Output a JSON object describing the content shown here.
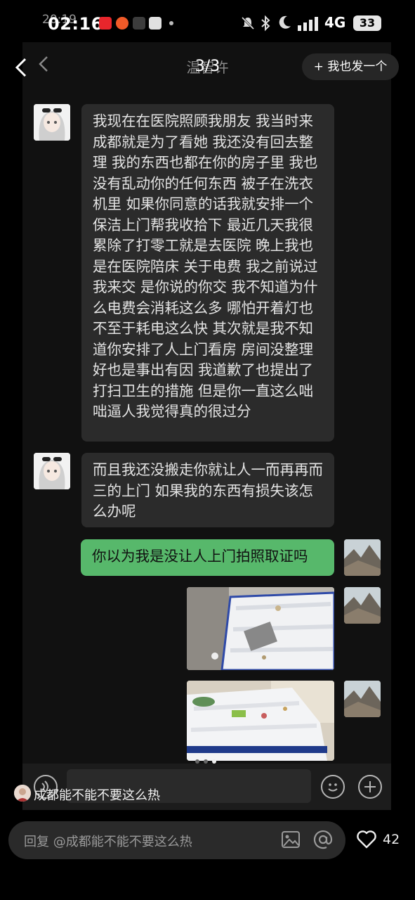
{
  "status_bar": {
    "time": "02:16",
    "time_ghost": "20:19",
    "network": "4G",
    "battery": "33"
  },
  "viewer": {
    "counter": "3/3",
    "follow_label": "+ 我也发一个"
  },
  "chat": {
    "title": "温智许",
    "messages": [
      {
        "from": "other",
        "text": "我现在在医院照顾我朋友 我当时来成都就是为了看她 我还没有回去整理 我的东西也都在你的房子里 我也没有乱动你的任何东西 被子在洗衣机里 如果你同意的话我就安排一个保洁上门帮我收拾下 最近几天我很累除了打零工就是去医院 晚上我也是在医院陪床 关于电费 我之前说过我来交 是你说的你交 我不知道为什么电费会消耗这么多 哪怕开着灯也不至于耗电这么快 其次就是我不知道你安排了人上门看房 房间没整理好也是事出有因 我道歉了也提出了打扫卫生的措施 但是你一直这么咄咄逼人我觉得真的很过分"
      },
      {
        "from": "other",
        "text": "而且我还没搬走你就让人一而再再而三的上门 如果我的东西有损失该怎么办呢"
      },
      {
        "from": "me",
        "text": "你以为我是没让人上门拍照取证吗"
      }
    ],
    "photos": [
      "mattress-photo-1",
      "mattress-photo-2"
    ]
  },
  "comment": {
    "text": "成都能不能不要这么热"
  },
  "reply": {
    "placeholder": "回复 @成都能不能不要这么热",
    "like_count": "42"
  },
  "colors": {
    "my_bubble": "#57b86b",
    "other_bubble": "#2b2b2b",
    "background": "#000000"
  }
}
